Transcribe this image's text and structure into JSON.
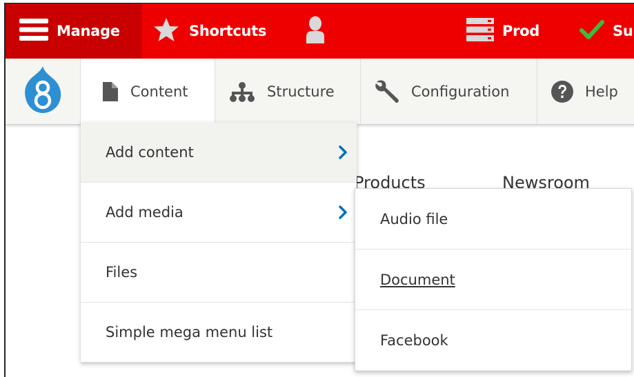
{
  "topbar": {
    "manage_label": "Manage",
    "shortcuts_label": "Shortcuts",
    "user_icon": "user-icon",
    "prod_label": "Prod",
    "su_label": "Su",
    "bg_color": "#ef0000",
    "active_color": "#c80000"
  },
  "adminbar": {
    "logo_icon": "drupal-logo",
    "tabs": [
      {
        "label": "Content",
        "icon": "document-icon"
      },
      {
        "label": "Structure",
        "icon": "hierarchy-icon"
      },
      {
        "label": "Configuration",
        "icon": "wrench-icon"
      },
      {
        "label": "Help",
        "icon": "help-icon"
      }
    ]
  },
  "background": {
    "products": "Products",
    "newsroom": "Newsroom"
  },
  "content_menu": {
    "items": [
      {
        "label": "Add content",
        "has_submenu": true,
        "active": true
      },
      {
        "label": "Add media",
        "has_submenu": true
      },
      {
        "label": "Files"
      },
      {
        "label": "Simple mega menu list"
      }
    ]
  },
  "media_submenu": {
    "items": [
      {
        "label": "Audio file"
      },
      {
        "label": "Document",
        "hover": true
      },
      {
        "label": "Facebook"
      }
    ]
  },
  "colors": {
    "chevron": "#0071b8",
    "checkmark": "#3dbb3d"
  }
}
